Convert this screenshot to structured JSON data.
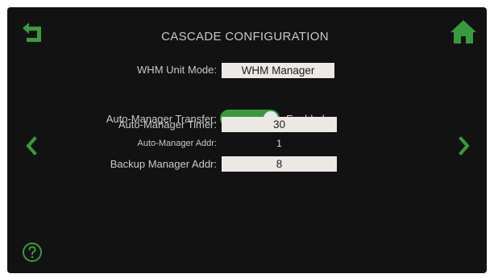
{
  "header": {
    "title": "CASCADE CONFIGURATION",
    "back_icon": "return-arrow-icon",
    "home_icon": "home-icon"
  },
  "settings": {
    "unit_mode": {
      "label": "WHM Unit Mode:",
      "value": "WHM Manager"
    },
    "auto_manager_transfer": {
      "label": "Auto-Manager Transfer:",
      "state": "Enabled",
      "on": true
    },
    "auto_manager_timer": {
      "label": "Auto-Manager Timer:",
      "value": "30"
    },
    "auto_manager_addr": {
      "label": "Auto-Manager Addr:",
      "value": "1"
    },
    "backup_manager_addr": {
      "label": "Backup Manager Addr:",
      "value": "8"
    }
  },
  "nav": {
    "prev_icon": "chevron-left-icon",
    "next_icon": "chevron-right-icon",
    "help_icon": "question-circle-icon"
  },
  "colors": {
    "accent": "#3a9a3f",
    "background": "#121212",
    "text": "#c9c9c9",
    "field": "#ece9e4"
  }
}
